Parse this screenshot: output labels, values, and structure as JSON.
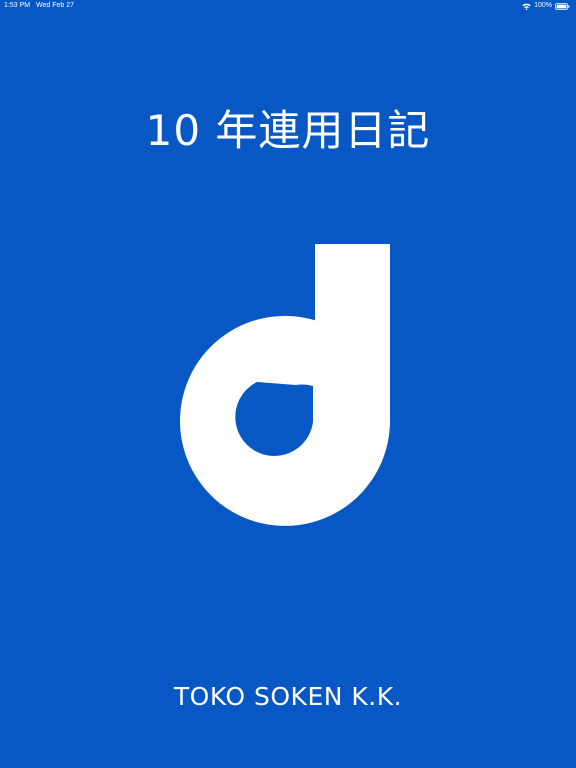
{
  "status_bar": {
    "time": "1:53 PM",
    "date": "Wed Feb 27",
    "battery_percent": "100%",
    "icons": [
      "wifi-icon",
      "battery-icon"
    ]
  },
  "splash": {
    "title": "10 年連用日記",
    "logo": "d-logo-icon",
    "company": "TOKO SOKEN K.K."
  },
  "colors": {
    "background": "#0758C5",
    "foreground": "#ffffff"
  }
}
